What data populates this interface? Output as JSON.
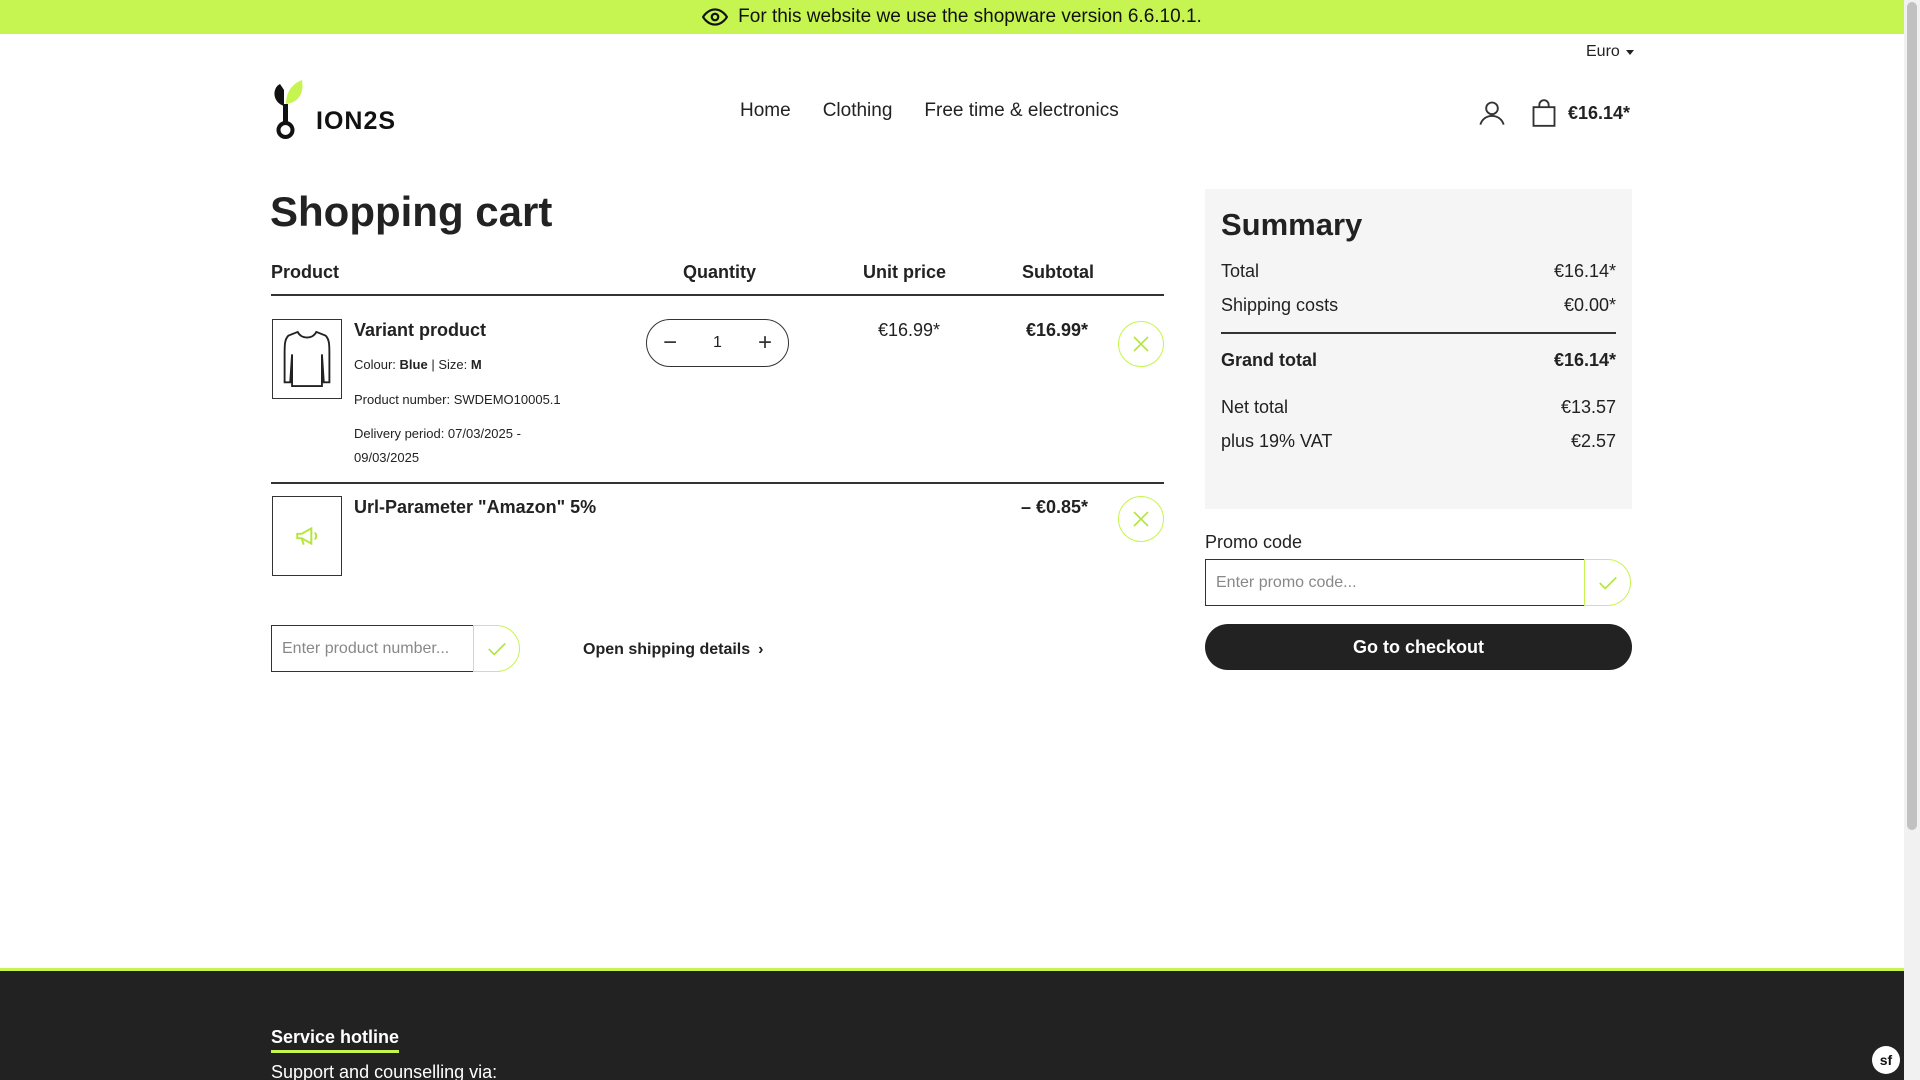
{
  "banner": {
    "text": "For this website we use the shopware version 6.6.10.1.",
    "icon": "eye-icon"
  },
  "header": {
    "currency": "Euro",
    "logo_text": "ION2S",
    "nav": [
      "Home",
      "Clothing",
      "Free time & electronics"
    ],
    "cart_total": "€16.14*"
  },
  "cart": {
    "title": "Shopping cart",
    "columns": {
      "product": "Product",
      "quantity": "Quantity",
      "unit_price": "Unit price",
      "subtotal": "Subtotal"
    },
    "items": [
      {
        "name": "Variant product",
        "colour_label": "Colour:",
        "colour": "Blue",
        "size_label": "Size:",
        "size": "M",
        "product_number": "Product number: SWDEMO10005.1",
        "delivery_line1": "Delivery period: 07/03/2025 -",
        "delivery_line2": "09/03/2025",
        "quantity": "1",
        "unit_price": "€16.99*",
        "subtotal": "€16.99*"
      },
      {
        "name": "Url-Parameter \"Amazon\" 5%",
        "subtotal": "– €0.85*"
      }
    ],
    "product_number_placeholder": "Enter product number...",
    "shipping_link": "Open shipping details"
  },
  "summary": {
    "title": "Summary",
    "total_label": "Total",
    "total": "€16.14*",
    "shipping_label": "Shipping costs",
    "shipping": "€0.00*",
    "grand_label": "Grand total",
    "grand": "€16.14*",
    "net_label": "Net total",
    "net": "€13.57",
    "vat_label": "plus 19% VAT",
    "vat": "€2.57"
  },
  "promo": {
    "label": "Promo code",
    "placeholder": "Enter promo code..."
  },
  "checkout_label": "Go to checkout",
  "footer": {
    "hotline": "Service hotline",
    "support": "Support and counselling via:"
  },
  "colors": {
    "accent": "#c6f551",
    "dark": "#222222"
  }
}
